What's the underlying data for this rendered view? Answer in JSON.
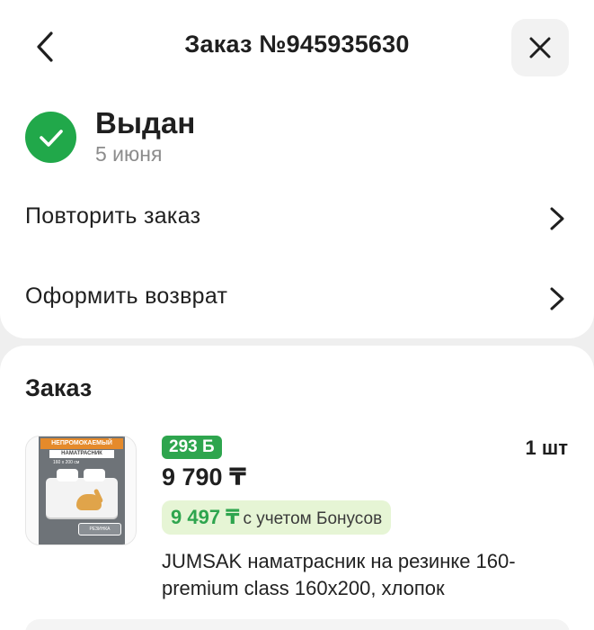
{
  "header": {
    "title": "Заказ №945935630",
    "back_icon": "chevron-left-icon",
    "close_icon": "close-icon"
  },
  "status": {
    "title": "Выдан",
    "date": "5 июня",
    "icon": "check-circle-icon",
    "color": "#21a84a"
  },
  "actions": [
    {
      "label": "Повторить заказ",
      "icon": "chevron-right-icon"
    },
    {
      "label": "Оформить возврат",
      "icon": "chevron-right-icon"
    }
  ],
  "order": {
    "section_title": "Заказ",
    "item": {
      "image_banner": "НЕПРОМОКАЕМЫЙ",
      "image_subtitle": "НАМАТРАСНИК",
      "image_size": "160 x 200 см",
      "image_logo": "РЕЗИНКА",
      "bonus": "293 Б",
      "quantity": "1 шт",
      "price": "9 790 ₸",
      "bonus_price": "9 497 ₸",
      "bonus_note": "с учетом Бонусов",
      "name": "JUMSAK наматрасник на резинке 160-premium class 160х200, хлопок"
    }
  },
  "colors": {
    "accent_green": "#2ea54e",
    "bonus_bg": "#e6f5d5",
    "page_bg": "#efefef"
  }
}
